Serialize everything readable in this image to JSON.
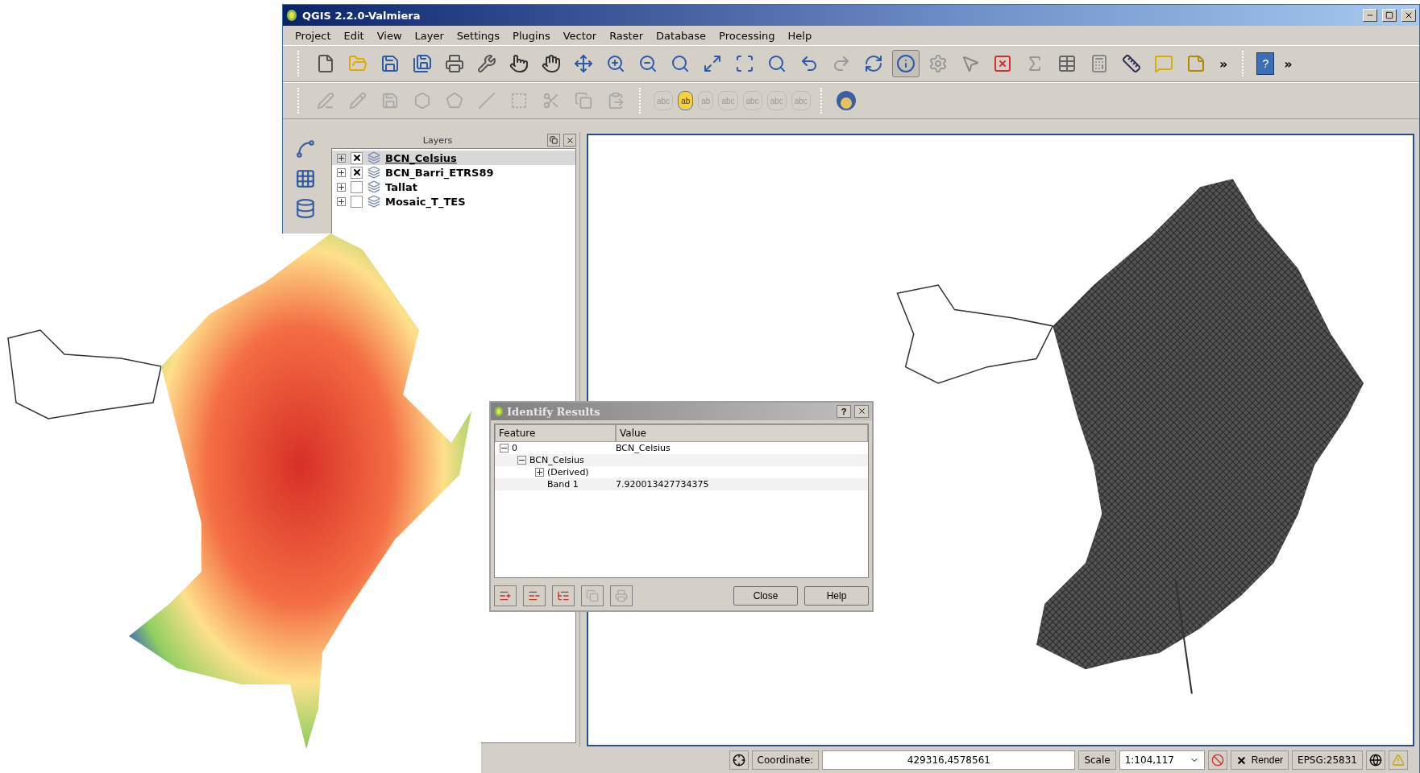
{
  "window": {
    "title": "QGIS 2.2.0-Valmiera"
  },
  "menu": [
    "Project",
    "Edit",
    "View",
    "Layer",
    "Settings",
    "Plugins",
    "Vector",
    "Raster",
    "Database",
    "Processing",
    "Help"
  ],
  "toolbar_1": {
    "tools": [
      {
        "selected": false
      },
      {
        "selected": false
      },
      {
        "selected": false
      },
      {
        "selected": false
      },
      {
        "selected": false
      },
      {
        "selected": false
      },
      {
        "selected": false
      },
      {
        "selected": false
      },
      {
        "selected": false
      },
      {
        "selected": false
      },
      {
        "selected": false
      },
      {
        "selected": false
      },
      {
        "selected": false
      },
      {
        "selected": false
      },
      {
        "selected": false
      },
      {
        "selected": false
      },
      {
        "selected": false
      },
      {
        "selected": false
      },
      {
        "selected": true
      },
      {
        "selected": false
      },
      {
        "selected": false
      },
      {
        "selected": false
      },
      {
        "selected": false
      },
      {
        "selected": false
      },
      {
        "selected": false
      },
      {
        "selected": false
      },
      {
        "selected": false
      },
      {
        "selected": false
      }
    ],
    "overflow": "»",
    "help": "?",
    "overflow_2": "»"
  },
  "toolbar_2": {
    "label_tools": [
      {
        "text": "abc",
        "disabled": true
      },
      {
        "text": "ab",
        "disabled": false
      },
      {
        "text": "ab",
        "disabled": true
      },
      {
        "text": "abc",
        "disabled": true
      },
      {
        "text": "abc",
        "disabled": true
      },
      {
        "text": "abc",
        "disabled": true
      },
      {
        "text": "abc",
        "disabled": true
      }
    ]
  },
  "layers_panel": {
    "title": "Layers",
    "layers": [
      {
        "name": "BCN_Celsius",
        "checked": true,
        "selected": true
      },
      {
        "name": "BCN_Barri_ETRS89",
        "checked": true,
        "selected": false
      },
      {
        "name": "Tallat",
        "checked": false,
        "selected": false
      },
      {
        "name": "Mosaic_T_TES",
        "checked": false,
        "selected": false
      }
    ]
  },
  "identify_dialog": {
    "title": "Identify Results",
    "help_button": "?",
    "columns": [
      "Feature",
      "Value"
    ],
    "rows": [
      {
        "feature": "0",
        "value": "BCN_Celsius",
        "expanded": true,
        "children": [
          {
            "feature": "BCN_Celsius",
            "expanded": true,
            "children": [
              {
                "feature": "(Derived)",
                "expanded": false
              },
              {
                "feature": "Band 1",
                "value": "7.920013427734375"
              }
            ]
          }
        ]
      }
    ],
    "tool_buttons": [
      {
        "disabled": false
      },
      {
        "disabled": false
      },
      {
        "disabled": false
      },
      {
        "disabled": true
      },
      {
        "disabled": true
      }
    ],
    "buttons": [
      "Close",
      "Help"
    ]
  },
  "status_bar": {
    "coordinate_label": "Coordinate:",
    "coordinate": "429316,4578561",
    "scale_label": "Scale",
    "scale": "1:104,117",
    "render_label": "Render",
    "render_checked": true,
    "crs": "EPSG:25831"
  }
}
